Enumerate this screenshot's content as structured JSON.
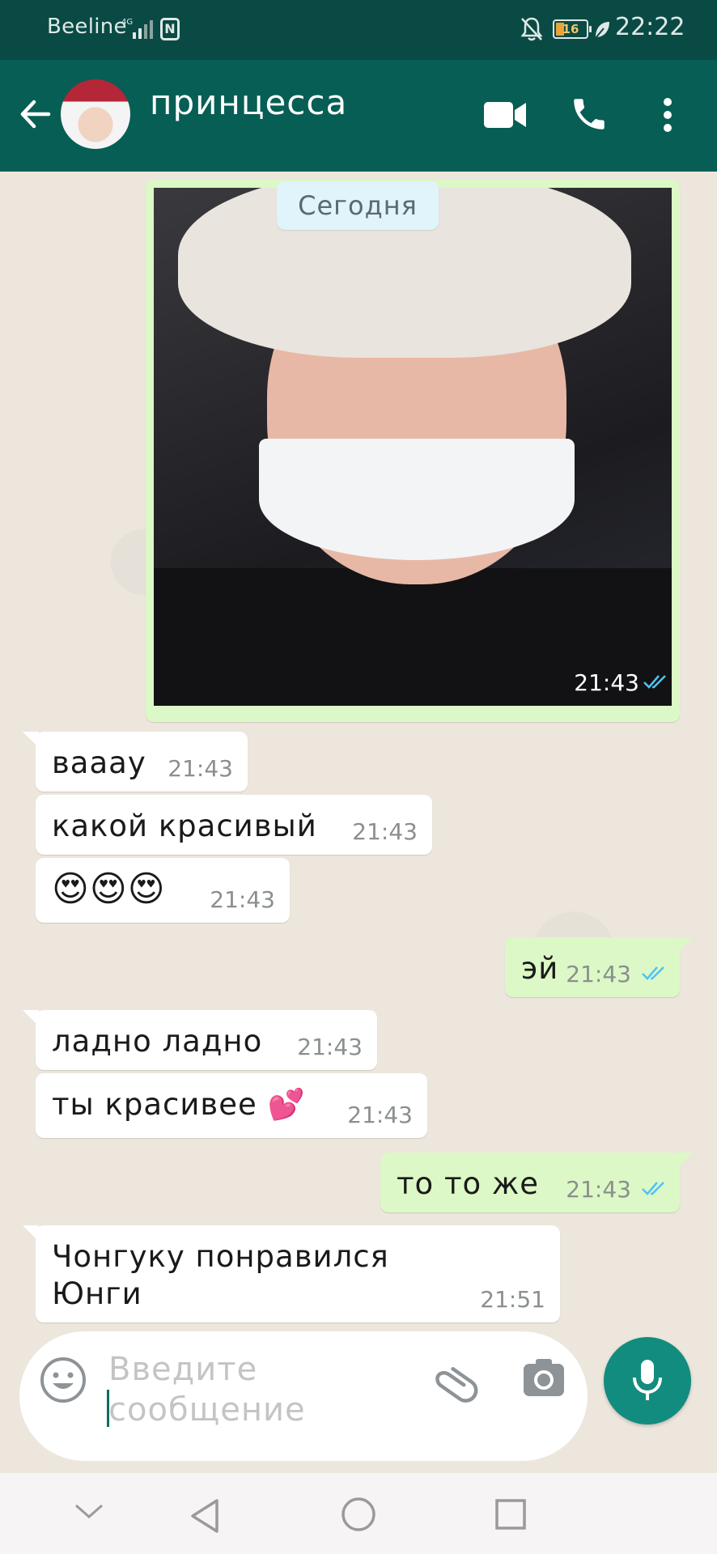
{
  "status_bar": {
    "carrier": "Beeline",
    "network": "4G",
    "battery_level": "16",
    "clock": "22:22"
  },
  "header": {
    "contact_name": "принцесса"
  },
  "chat": {
    "date_chip": "Сегодня",
    "photo_message": {
      "time": "21:43",
      "status": "read"
    },
    "messages": [
      {
        "direction": "in",
        "text": "вааау",
        "time": "21:43"
      },
      {
        "direction": "in",
        "text": "какой красивый",
        "time": "21:43"
      },
      {
        "direction": "in",
        "text": "😍😍😍",
        "time": "21:43"
      },
      {
        "direction": "out",
        "text": "эй",
        "time": "21:43",
        "status": "read"
      },
      {
        "direction": "in",
        "text": "ладно ладно",
        "time": "21:43"
      },
      {
        "direction": "in",
        "text": "ты красивее 💕",
        "time": "21:43"
      },
      {
        "direction": "out",
        "text": "то то же",
        "time": "21:43",
        "status": "read"
      },
      {
        "direction": "in",
        "text": "Чонгуку понравился Юнги",
        "time": "21:51"
      }
    ]
  },
  "composer": {
    "placeholder": "Введите сообщение"
  },
  "colors": {
    "header": "#075e54",
    "status_bar": "#0a4a44",
    "outgoing_bubble": "#dcf8c6",
    "incoming_bubble": "#ffffff",
    "read_ticks": "#4fc3f7",
    "mic_button": "#128c7e"
  },
  "icons": {
    "back": "arrow-left-icon",
    "video": "video-camera-icon",
    "call": "phone-icon",
    "menu": "more-vertical-icon",
    "emoji": "emoji-icon",
    "attach": "paperclip-icon",
    "camera": "camera-icon",
    "mic": "microphone-icon"
  }
}
